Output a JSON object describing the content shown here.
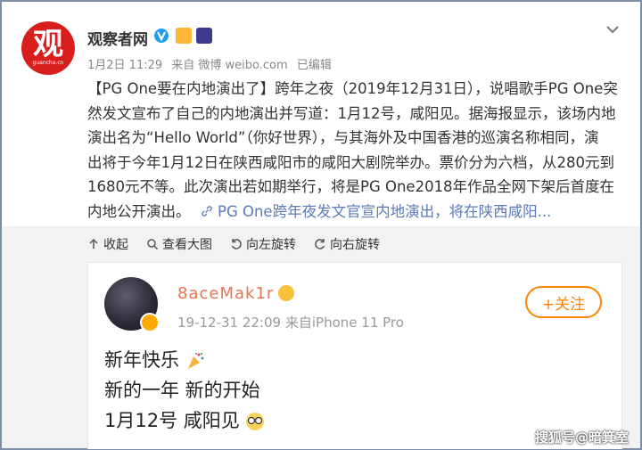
{
  "post": {
    "author": "观察者网",
    "avatar_text": "观",
    "avatar_subtext": "guancha.cn",
    "date": "1月2日 11:29",
    "source": "来自 微博 weibo.com",
    "edited": "已编辑",
    "body_tag": "【PG One要在内地演出了】",
    "body_line_1_rest": "跨年之夜（2019年12月31日），说唱歌手PG One突",
    "body_line_2": "然发文宣布了自己的内地演出并写道：1月12号，咸阳见。据海报显示，该场内地",
    "body_line_3": "演出名为“Hello World”（你好世界），与其海外及中国香港的巡演名称相同，演",
    "body_line_4": "出将于今年1月12日在陕西咸阳市的咸阳大剧院举办。票价分为六档，从280元到",
    "body_line_5": "1680元不等。此次演出若如期举行，将是PG One2018年作品全网下架后首度在",
    "body_line_6_start": "内地公开演出。",
    "body_link": "PG One跨年夜发文官宣内地演出，将在陕西咸阳..."
  },
  "toolbar": {
    "collapse": "收起",
    "view_large": "查看大图",
    "rotate_left": "向左旋转",
    "rotate_right": "向右旋转"
  },
  "repost": {
    "author": "8aceMak1r",
    "date": "19-12-31 22:09",
    "source": "来自iPhone 11 Pro",
    "follow_label": "+关注",
    "line_1": "新年快乐",
    "line_2": "新的一年 新的开始",
    "line_3": "1月12号 咸阳见"
  },
  "watermark": "搜狐号@暗箕室",
  "colors": {
    "accent_orange": "#ff8200",
    "link_blue": "#5b7bb7",
    "avatar_red": "#d91e1e"
  }
}
